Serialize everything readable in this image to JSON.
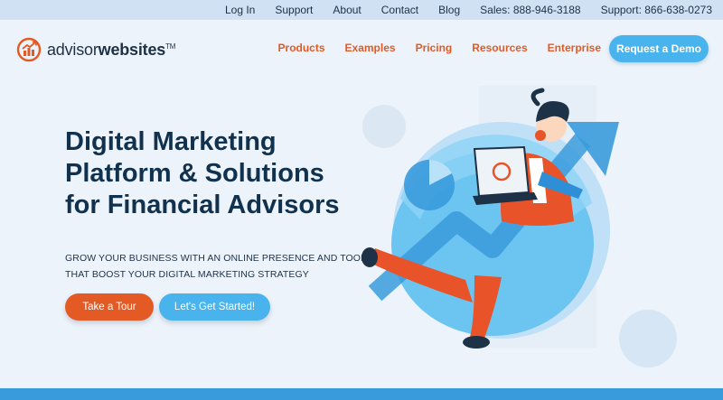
{
  "topbar": {
    "links": [
      {
        "label": "Log In"
      },
      {
        "label": "Support"
      },
      {
        "label": "About"
      },
      {
        "label": "Contact"
      },
      {
        "label": "Blog"
      },
      {
        "label": "Sales: 888-946-3188"
      },
      {
        "label": "Support: 866-638-0273"
      }
    ]
  },
  "logo": {
    "text_light": "advisor",
    "text_bold": "websites",
    "trademark": "TM"
  },
  "nav": {
    "items": [
      {
        "label": "Products"
      },
      {
        "label": "Examples"
      },
      {
        "label": "Pricing"
      },
      {
        "label": "Resources"
      },
      {
        "label": "Enterprise"
      }
    ],
    "cta_label": "Request a Demo"
  },
  "hero": {
    "title_lines": [
      "Digital Marketing",
      "Platform & Solutions",
      "for Financial Advisors"
    ],
    "subtitle_lines": [
      "GROW YOUR BUSINESS WITH AN ONLINE PRESENCE AND TOOLS",
      "THAT BOOST YOUR DIGITAL MARKETING STRATEGY"
    ],
    "primary_button": "Take a Tour",
    "secondary_button": "Let's Get Started!"
  },
  "colors": {
    "accent_orange": "#e35a25",
    "accent_blue": "#48b3ec",
    "background": "#edf3fa",
    "topbar": "#cfe1f2",
    "heading": "#10324f"
  },
  "icons": {
    "logo_mark": "chart-arrow-logo-icon",
    "illustration": "businessman-with-laptop-illustration"
  }
}
